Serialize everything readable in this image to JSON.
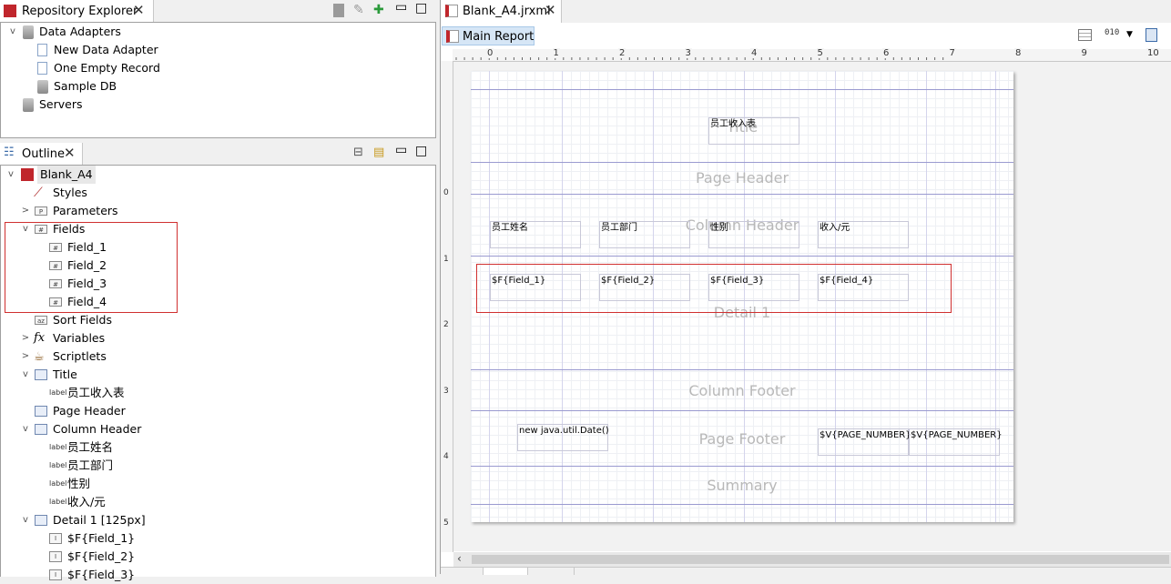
{
  "repo": {
    "tab_title": "Repository Explorer",
    "items": [
      "Data Adapters",
      "New Data Adapter",
      "One Empty Record",
      "Sample DB",
      "Servers"
    ]
  },
  "outline": {
    "tab_title": "Outline",
    "root": "Blank_A4",
    "styles": "Styles",
    "parameters": "Parameters",
    "fields": "Fields",
    "field_items": [
      "Field_1",
      "Field_2",
      "Field_3",
      "Field_4"
    ],
    "sort_fields": "Sort Fields",
    "variables": "Variables",
    "variables_icon": "fx",
    "scriptlets": "Scriptlets",
    "title_band": "Title",
    "title_label": "员工收入表",
    "page_header": "Page Header",
    "column_header": "Column Header",
    "column_labels": [
      "员工姓名",
      "员工部门",
      "性别",
      "收入/元"
    ],
    "detail": "Detail 1 [125px]",
    "detail_items": [
      "$F{Field_1}",
      "$F{Field_2}",
      "$F{Field_3}"
    ],
    "label_tag": "label"
  },
  "editor": {
    "tab_title": "Blank_A4.jrxml",
    "main_report": "Main Report"
  },
  "ruler": {
    "h_marks": [
      "0",
      "1",
      "2",
      "3",
      "4",
      "5",
      "6",
      "7",
      "8",
      "9",
      "10"
    ],
    "v_marks": [
      "0",
      "1",
      "2",
      "3",
      "4",
      "5"
    ]
  },
  "report": {
    "bands": {
      "title": "Title",
      "page_header": "Page Header",
      "column_header": "Column Header",
      "detail": "Detail 1",
      "column_footer": "Column Footer",
      "page_footer": "Page Footer",
      "summary": "Summary"
    },
    "title_text": "员工收入表",
    "col_headers": [
      "员工姓名",
      "员工部门",
      "性别",
      "收入/元"
    ],
    "detail_fields": [
      "$F{Field_1}",
      "$F{Field_2}",
      "$F{Field_3}",
      "$F{Field_4}"
    ],
    "date_expr": "new java.util.Date()",
    "page_number_1": "$V{PAGE_NUMBER}",
    "page_number_2": "$V{PAGE_NUMBER}"
  },
  "colors": {
    "highlight_box": "#d03030",
    "band_line": "#9a9ad0",
    "band_label": "#b8b8b8"
  }
}
